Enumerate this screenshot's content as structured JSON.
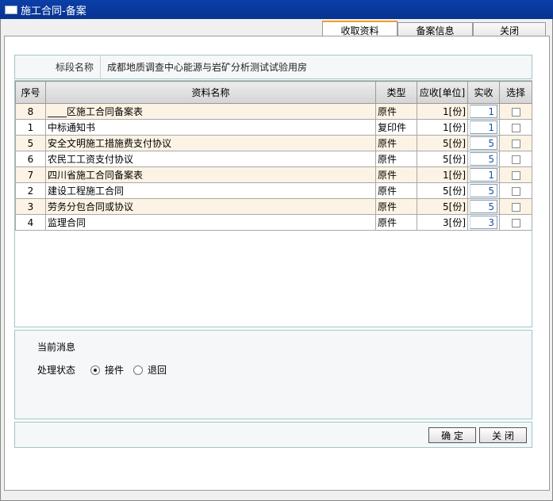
{
  "window": {
    "title": "施工合同-备案"
  },
  "tabs": [
    "收取资料",
    "备案信息",
    "关闭"
  ],
  "field": {
    "label": "标段名称",
    "value": "成都地质调查中心能源与岩矿分析测试试验用房"
  },
  "table": {
    "headers": [
      "序号",
      "资料名称",
      "类型",
      "应收[单位]",
      "实收",
      "选择"
    ],
    "rows": [
      {
        "seq": "8",
        "name": "____区施工合同备案表",
        "type": "原件",
        "due": "1[份]",
        "received": "1"
      },
      {
        "seq": "1",
        "name": "中标通知书",
        "type": "复印件",
        "due": "1[份]",
        "received": "1"
      },
      {
        "seq": "5",
        "name": "安全文明施工措施费支付协议",
        "type": "原件",
        "due": "5[份]",
        "received": "5"
      },
      {
        "seq": "6",
        "name": "农民工工资支付协议",
        "type": "原件",
        "due": "5[份]",
        "received": "5"
      },
      {
        "seq": "7",
        "name": "四川省施工合同备案表",
        "type": "原件",
        "due": "1[份]",
        "received": "1"
      },
      {
        "seq": "2",
        "name": "建设工程施工合同",
        "type": "原件",
        "due": "5[份]",
        "received": "5"
      },
      {
        "seq": "3",
        "name": "劳务分包合同或协议",
        "type": "原件",
        "due": "5[份]",
        "received": "5"
      },
      {
        "seq": "4",
        "name": "监理合同",
        "type": "原件",
        "due": "3[份]",
        "received": "3"
      }
    ]
  },
  "message": {
    "title": "当前消息",
    "status_label": "处理状态",
    "options": [
      "接件",
      "退回"
    ],
    "selected": "接件"
  },
  "buttons": {
    "ok": "确 定",
    "close": "关 闭"
  }
}
